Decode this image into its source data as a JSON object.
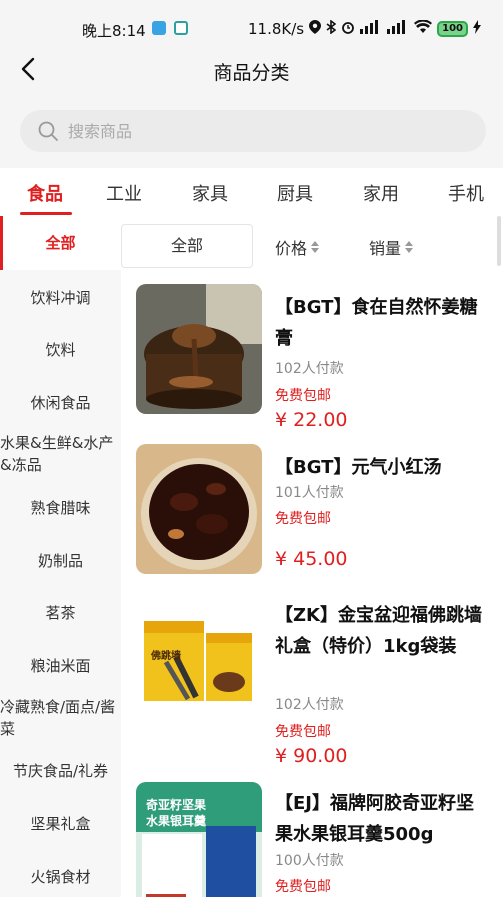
{
  "status_bar": {
    "time": "晚上8:14",
    "net_speed": "11.8K/s",
    "battery": "100"
  },
  "header": {
    "title": "商品分类",
    "back_icon": "chevron-left-icon"
  },
  "search": {
    "placeholder": "搜索商品",
    "icon": "search-icon"
  },
  "category_tabs": [
    "食品",
    "工业",
    "家具",
    "厨具",
    "家用",
    "手机"
  ],
  "sidebar": {
    "items": [
      "全部",
      "饮料冲调",
      "饮料",
      "休闲食品",
      "水果&生鲜&水产&冻品",
      "熟食腊味",
      "奶制品",
      "茗茶",
      "粮油米面",
      "冷藏熟食/面点/酱菜",
      "节庆食品/礼券",
      "坚果礼盒",
      "火锅食材"
    ]
  },
  "sort_bar": {
    "all": "全部",
    "price": "价格",
    "sales": "销量"
  },
  "products": [
    {
      "name": "【BGT】食在自然怀姜糖膏",
      "sold": "102人付款",
      "shipping": "免费包邮",
      "price": "¥ 22.00"
    },
    {
      "name": "【BGT】元气小红汤",
      "sold": "101人付款",
      "shipping": "免费包邮",
      "price": "¥ 45.00"
    },
    {
      "name": "【ZK】金宝盆迎福佛跳墙礼盒（特价）1kg袋装",
      "sold": "102人付款",
      "shipping": "免费包邮",
      "price": "¥ 90.00"
    },
    {
      "name": "【EJ】福牌阿胶奇亚籽坚果水果银耳羹500g",
      "sold": "100人付款",
      "shipping": "免费包邮",
      "price": ""
    }
  ],
  "product_images": {
    "p3_box_text": "佛跳墙",
    "p4_banner_line1": "奇亚籽坚果",
    "p4_banner_line2": "水果银耳羹"
  },
  "colors": {
    "accent": "#e02020",
    "background": "#f5f5f5"
  }
}
